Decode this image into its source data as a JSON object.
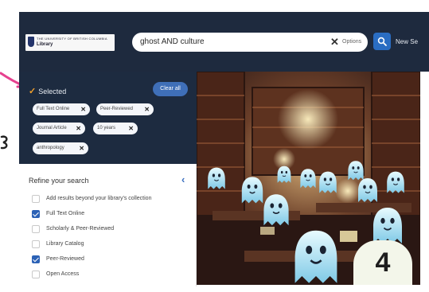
{
  "header": {
    "logo": {
      "line1": "THE UNIVERSITY OF BRITISH COLUMBIA",
      "line2": "Library"
    },
    "search": {
      "query": "ghost AND culture",
      "clear_symbol": "✕",
      "options_label": "Options"
    },
    "new_search_label": "New Se"
  },
  "selected": {
    "title": "Selected",
    "clear_all_label": "Clear all",
    "chips": [
      {
        "label": "Full Text Online"
      },
      {
        "label": "Peer-Reviewed"
      },
      {
        "label": "Journal Article"
      },
      {
        "label": "10 years"
      },
      {
        "label": "anthropology"
      }
    ]
  },
  "refine": {
    "title": "Refine your search",
    "collapse_symbol": "‹",
    "facets": [
      {
        "label": "Add results beyond your library's collection",
        "checked": false
      },
      {
        "label": "Full Text Online",
        "checked": true
      },
      {
        "label": "Scholarly & Peer-Reviewed",
        "checked": false
      },
      {
        "label": "Library Catalog",
        "checked": false
      },
      {
        "label": "Peer-Reviewed",
        "checked": true
      },
      {
        "label": "Open Access",
        "checked": false
      }
    ]
  },
  "step_badge": "4",
  "colors": {
    "header_bg": "#1e2a3e",
    "panel_bg": "#1d2b40",
    "accent_blue": "#2a6dc2",
    "check_orange": "#f2a02b",
    "annotation_pink": "#e6418f"
  }
}
